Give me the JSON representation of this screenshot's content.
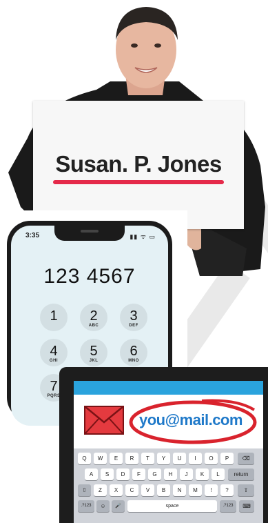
{
  "name_card": {
    "name": "Susan. P. Jones"
  },
  "phone": {
    "time": "3:35",
    "status_icons": "▮▮ ᯤ ▭",
    "number": "123 4567",
    "keys": [
      {
        "digit": "1",
        "letters": ""
      },
      {
        "digit": "2",
        "letters": "ABC"
      },
      {
        "digit": "3",
        "letters": "DEF"
      },
      {
        "digit": "4",
        "letters": "GHI"
      },
      {
        "digit": "5",
        "letters": "JKL"
      },
      {
        "digit": "6",
        "letters": "MNO"
      },
      {
        "digit": "7",
        "letters": "PQRS"
      }
    ]
  },
  "tablet": {
    "email": "you@mail.com",
    "keyboard": {
      "row1": [
        "Q",
        "W",
        "E",
        "R",
        "T",
        "Y",
        "U",
        "I",
        "O",
        "P",
        "⌫"
      ],
      "row2": [
        "A",
        "S",
        "D",
        "F",
        "G",
        "H",
        "J",
        "K",
        "L",
        "return"
      ],
      "row3": [
        "⇧",
        "Z",
        "X",
        "C",
        "V",
        "B",
        "N",
        "M",
        "!",
        "?",
        "⇧"
      ],
      "row4": [
        ".?123",
        "☺",
        "🎤",
        "space",
        ".?123",
        "⌨"
      ]
    }
  },
  "colors": {
    "underline": "#e52a4a",
    "email_blue": "#1f79c9",
    "header_blue": "#2aa3dd",
    "red_circle": "#d9232d"
  }
}
